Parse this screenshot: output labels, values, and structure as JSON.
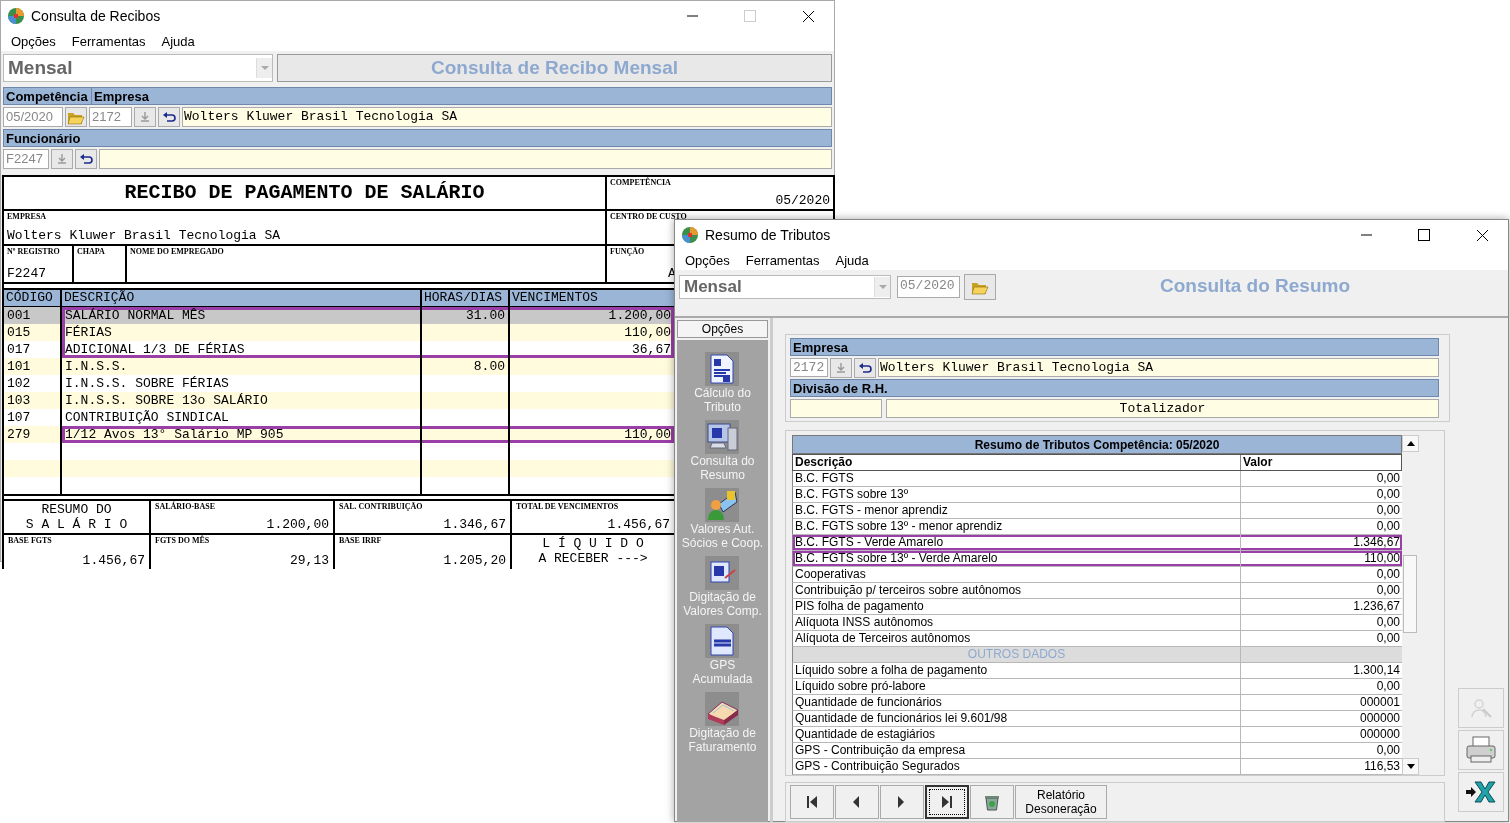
{
  "receipts_window": {
    "title": "Consulta de Recibos",
    "maximize_enabled": false,
    "menu": [
      "Opções",
      "Ferramentas",
      "Ajuda"
    ],
    "period_type": "Mensal",
    "heading": "Consulta de Recibo Mensal",
    "competencia_label": "Competência",
    "empresa_label": "Empresa",
    "competencia": "05/2020",
    "empresa_code": "2172",
    "empresa_name": "Wolters Kluwer Brasil Tecnologia SA",
    "funcionario_label": "Funcionário",
    "funcionario_code": "F2247",
    "receipt": {
      "title": "RECIBO DE PAGAMENTO DE SALÁRIO",
      "competencia_label": "COMPETÊNCIA",
      "competencia": "05/2020",
      "empresa_label": "EMPRESA",
      "empresa": "Wolters Kluwer Brasil Tecnologia SA",
      "centro_label": "CENTRO DE CUSTO",
      "registro_label": "Nº REGISTRO",
      "registro": "F2247",
      "chapa_label": "CHAPA",
      "nome_label": "NOME DO EMPREGADO",
      "funcao_label": "FUNÇÃO",
      "funcao": "A",
      "columns": [
        "CÓDIGO",
        "DESCRIÇÃO",
        "HORAS/DIAS",
        "VENCIMENTOS"
      ],
      "rows": [
        {
          "code": "001",
          "description": "SALÁRIO NORMAL MÊS",
          "hours": "31.00",
          "earnings": "1.200,00",
          "selected": true,
          "highlighted": true
        },
        {
          "code": "015",
          "description": "FÉRIAS",
          "earnings": "110,00",
          "selected": false,
          "highlighted": true
        },
        {
          "code": "017",
          "description": "ADICIONAL 1/3 DE FÉRIAS",
          "earnings": "36,67",
          "selected": false,
          "highlighted": true
        },
        {
          "code": "101",
          "description": "I.N.S.S.",
          "hours": "8.00",
          "selected": false,
          "highlighted": false
        },
        {
          "code": "102",
          "description": "I.N.S.S. SOBRE FÉRIAS",
          "selected": false,
          "highlighted": false
        },
        {
          "code": "103",
          "description": "I.N.S.S. SOBRE 13o SALÁRIO",
          "selected": false,
          "highlighted": false
        },
        {
          "code": "107",
          "description": "CONTRIBUIÇÃO SINDICAL",
          "selected": false,
          "highlighted": false
        },
        {
          "code": "279",
          "description": "1/12 Avos 13° Salário MP 905",
          "earnings": "110,00",
          "selected": false,
          "highlighted": true
        }
      ],
      "summary": [
        [
          {
            "kind": "title",
            "text": "RESUMO DO\nS A L Á R I O"
          },
          {
            "kind": "field",
            "label": "SALÁRIO-BASE",
            "value": "1.200,00"
          },
          {
            "kind": "field",
            "label": "SAL. CONTRIBUIÇÃO",
            "value": "1.346,67"
          },
          {
            "kind": "field",
            "label": "TOTAL DE VENCIMENTOS",
            "value": "1.456,67"
          }
        ],
        [
          {
            "kind": "field",
            "label": "BASE FGTS",
            "value": "1.456,67"
          },
          {
            "kind": "field",
            "label": "FGTS DO MÊS",
            "value": "29,13"
          },
          {
            "kind": "field",
            "label": "BASE IRRF",
            "value": "1.205,20"
          },
          {
            "kind": "title",
            "text": "L Í Q U I D O\nA RECEBER --->"
          }
        ]
      ]
    }
  },
  "tributos_window": {
    "title": "Resumo de Tributos",
    "maximize_enabled": true,
    "menu": [
      "Opções",
      "Ferramentas",
      "Ajuda"
    ],
    "period_type": "Mensal",
    "competencia": "05/2020",
    "heading": "Consulta do Resumo",
    "options_label": "Opções",
    "options": [
      {
        "label": "Cálculo do\nTributo"
      },
      {
        "label": "Consulta do\nResumo"
      },
      {
        "label": "Valores Aut.\nSócios e  Coop."
      },
      {
        "label": "Digitação de\nValores Comp."
      },
      {
        "label": "GPS\nAcumulada"
      },
      {
        "label": "Digitação de\nFaturamento"
      }
    ],
    "empresa_label": "Empresa",
    "empresa_code": "2172",
    "empresa_name": "Wolters Kluwer Brasil Tecnologia SA",
    "divisao_label": "Divisão de R.H.",
    "divisao_name": "Totalizador",
    "table": {
      "title": "Resumo de Tributos Competência: 05/2020",
      "columns": [
        "Descrição",
        "Valor"
      ],
      "rows": [
        {
          "kind": "row",
          "description": "B.C. FGTS",
          "value": "0,00",
          "highlighted": false
        },
        {
          "kind": "row",
          "description": "B.C. FGTS sobre 13º",
          "value": "0,00",
          "highlighted": false
        },
        {
          "kind": "row",
          "description": "B.C. FGTS - menor aprendiz",
          "value": "0,00",
          "highlighted": false
        },
        {
          "kind": "row",
          "description": "B.C. FGTS sobre 13º - menor aprendiz",
          "value": "0,00",
          "highlighted": false
        },
        {
          "kind": "row",
          "description": "B.C. FGTS - Verde Amarelo",
          "value": "1.346,67",
          "highlighted": true
        },
        {
          "kind": "row",
          "description": "B.C. FGTS sobre 13º - Verde Amarelo",
          "value": "110,00",
          "highlighted": true
        },
        {
          "kind": "row",
          "description": "Cooperativas",
          "value": "0,00",
          "highlighted": false
        },
        {
          "kind": "row",
          "description": "Contribuição p/ terceiros sobre autônomos",
          "value": "0,00",
          "highlighted": false
        },
        {
          "kind": "row",
          "description": "PIS folha de pagamento",
          "value": "1.236,67",
          "highlighted": false
        },
        {
          "kind": "row",
          "description": "Alíquota INSS autônomos",
          "value": "0,00",
          "highlighted": false
        },
        {
          "kind": "row",
          "description": "Alíquota de Terceiros autônomos",
          "value": "0,00",
          "highlighted": false
        },
        {
          "kind": "section",
          "description": "OUTROS DADOS"
        },
        {
          "kind": "row",
          "description": "Líquido sobre a folha de pagamento",
          "value": "1.300,14",
          "highlighted": false
        },
        {
          "kind": "row",
          "description": "Líquido sobre pró-labore",
          "value": "0,00",
          "highlighted": false
        },
        {
          "kind": "row",
          "description": "Quantidade de funcionários",
          "value": "000001",
          "highlighted": false
        },
        {
          "kind": "row",
          "description": "Quantidade de funcionários lei 9.601/98",
          "value": "000000",
          "highlighted": false
        },
        {
          "kind": "row",
          "description": "Quantidade de estagiários",
          "value": "000000",
          "highlighted": false
        },
        {
          "kind": "row",
          "description": "GPS - Contribuição da empresa",
          "value": "0,00",
          "highlighted": false
        },
        {
          "kind": "row",
          "description": "GPS - Contribuição Segurados",
          "value": "116,53",
          "highlighted": false
        }
      ]
    },
    "nav_buttons": [
      {
        "selected": false
      },
      {
        "selected": false
      },
      {
        "selected": false
      },
      {
        "selected": true
      }
    ],
    "report_button": "Relatório\nDesoneração",
    "side_tools": [
      {
        "disabled": true
      },
      {
        "disabled": false
      },
      {
        "disabled": false
      }
    ]
  }
}
